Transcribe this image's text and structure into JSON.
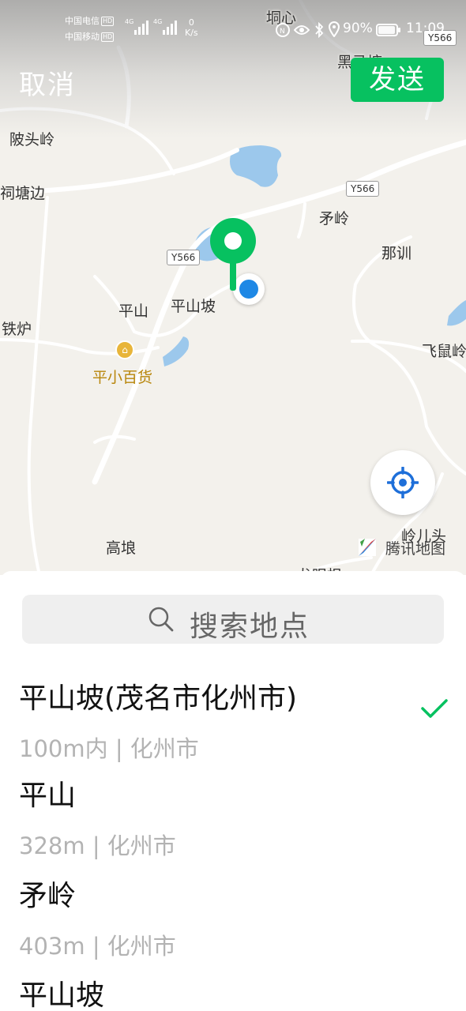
{
  "status_bar": {
    "carrier_1": "中国电信",
    "carrier_2": "中国移动",
    "hd_badge": "HD",
    "network_type": "4G",
    "net_speed_value": "0",
    "net_speed_unit": "K/s",
    "battery_percent": "90%",
    "time": "11:09"
  },
  "header": {
    "cancel_label": "取消",
    "send_label": "发送",
    "accent_color": "#07c160"
  },
  "map": {
    "places": {
      "dong_xin": "垌心",
      "hei_ma": "黑马塘",
      "ling_tou": "陂头岭",
      "tang_bian": "祠塘边",
      "mao_ling": "矛岭",
      "na_xun": "那训",
      "ping_shan": "平山",
      "ping_shan_po": "平山坡",
      "tie_lu": "铁炉",
      "fei_shu": "飞鼠岭",
      "gao_lang": "高埌",
      "ling_er": "岭儿头",
      "long_yan": "龙眼根"
    },
    "roads": {
      "road_top_right": "Y566",
      "road_middle": "Y566",
      "road_left": "Y566"
    },
    "poi_store": "平小百货",
    "provider": "腾讯地图",
    "pin_color": "#07c160",
    "user_dot_color": "#1e88e5"
  },
  "search": {
    "placeholder": "搜索地点"
  },
  "results": [
    {
      "name": "平山坡(茂名市化州市)",
      "meta": "100m内 | 化州市",
      "selected": true
    },
    {
      "name": "平山",
      "meta": "328m | 化州市",
      "selected": false
    },
    {
      "name": "矛岭",
      "meta": "403m | 化州市",
      "selected": false
    },
    {
      "name": "平山坡",
      "meta": "",
      "selected": false
    }
  ]
}
